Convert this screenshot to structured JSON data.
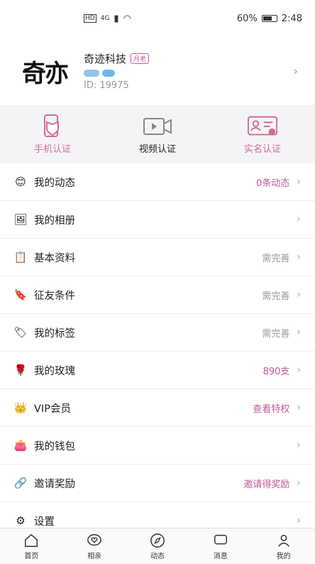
{
  "status": {
    "battery": "60%",
    "time": "2:48",
    "net": "4G"
  },
  "profile": {
    "logo_text": "奇亦",
    "name": "奇迹科技",
    "tag": "月老",
    "id": "ID: 19975"
  },
  "verify": [
    {
      "label": "手机认证",
      "color": "#d46a9a"
    },
    {
      "label": "视频认证",
      "color": "#333333"
    },
    {
      "label": "实名认证",
      "color": "#d46a9a"
    }
  ],
  "menu": [
    {
      "label": "我的动态",
      "value": "0条动态",
      "value_color": "#c05a9a",
      "icon": "emoji-icon",
      "glyph": "😊"
    },
    {
      "label": "我的相册",
      "value": "",
      "value_color": "#999999",
      "icon": "photo-icon",
      "glyph": "🖼"
    },
    {
      "label": "基本资料",
      "value": "需完善",
      "value_color": "#999999",
      "icon": "profile-doc-icon",
      "glyph": "📋"
    },
    {
      "label": "征友条件",
      "value": "需完善",
      "value_color": "#999999",
      "icon": "bookmark-icon",
      "glyph": "🔖"
    },
    {
      "label": "我的标签",
      "value": "需完善",
      "value_color": "#999999",
      "icon": "tag-icon",
      "glyph": "🏷"
    },
    {
      "label": "我的玫瑰",
      "value": "890支",
      "value_color": "#c05a9a",
      "icon": "rose-icon",
      "glyph": "🌹"
    },
    {
      "label": "VIP会员",
      "value": "查看特权",
      "value_color": "#c05a9a",
      "icon": "vip-crown-icon",
      "glyph": "👑"
    },
    {
      "label": "我的钱包",
      "value": "",
      "value_color": "#999999",
      "icon": "wallet-icon",
      "glyph": "👛"
    },
    {
      "label": "邀请奖励",
      "value": "邀请得奖励",
      "value_color": "#c05a9a",
      "icon": "share-icon",
      "glyph": "🔗"
    },
    {
      "label": "设置",
      "value": "",
      "value_color": "#999999",
      "icon": "settings-icon",
      "glyph": "⚙"
    }
  ],
  "tabs": [
    {
      "label": "首页"
    },
    {
      "label": "相亲"
    },
    {
      "label": "动态"
    },
    {
      "label": "消息"
    },
    {
      "label": "我的"
    }
  ]
}
